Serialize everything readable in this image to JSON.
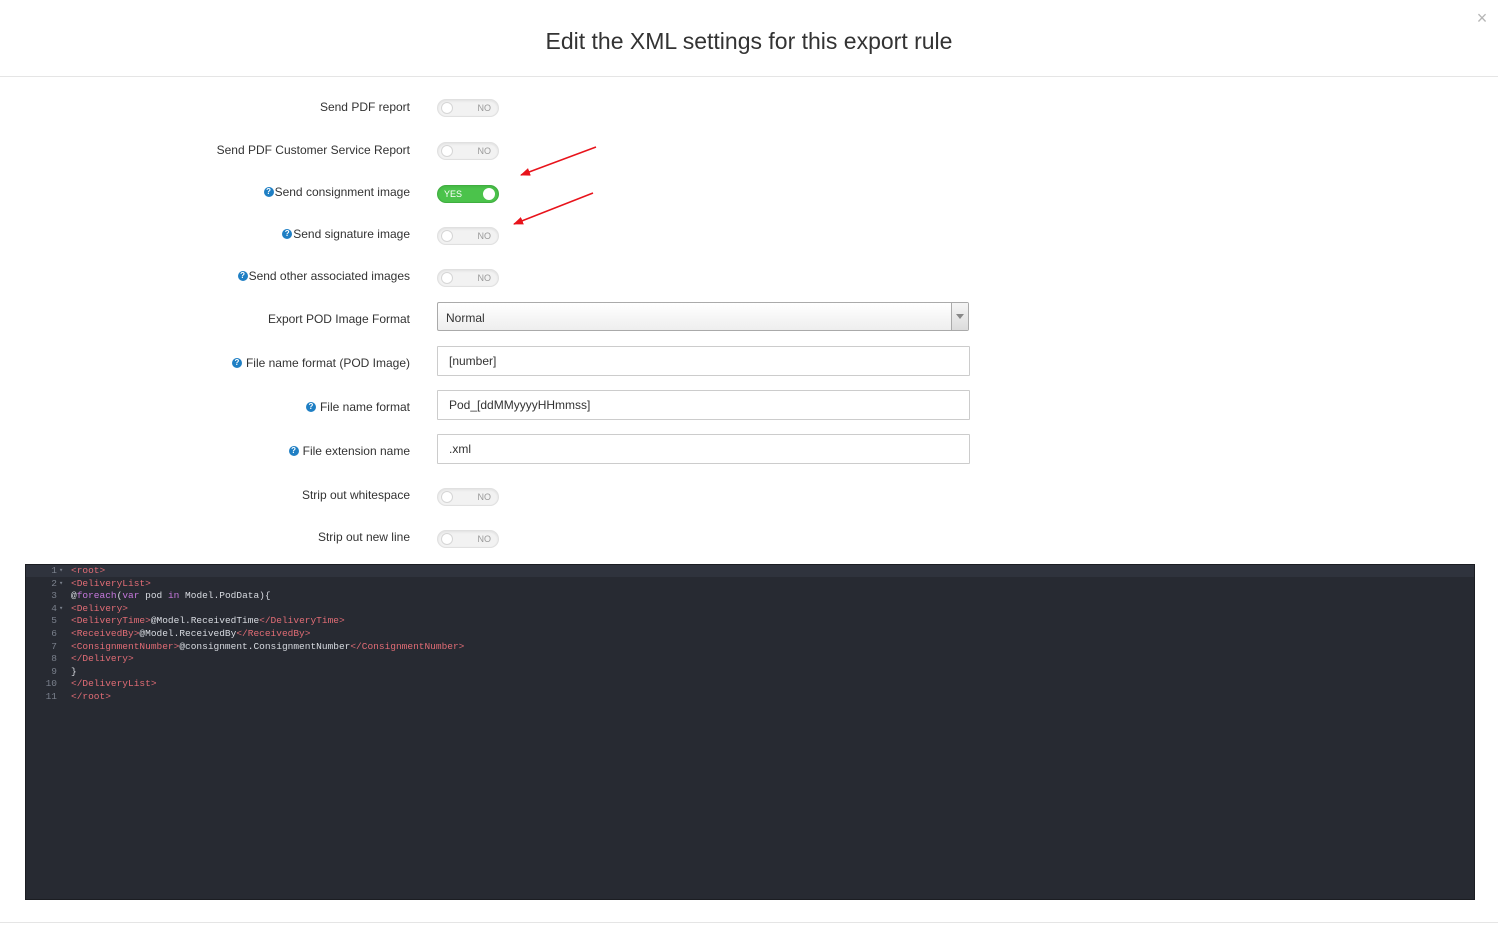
{
  "modal": {
    "title": "Edit the XML settings for this export rule",
    "close_label": "×"
  },
  "settings": {
    "send_pdf_report": {
      "label": "Send PDF report",
      "state": "NO"
    },
    "send_pdf_csr": {
      "label": "Send PDF Customer Service Report",
      "state": "NO"
    },
    "send_consignment_image": {
      "label": "Send consignment image",
      "state": "YES"
    },
    "send_signature_image": {
      "label": "Send signature image",
      "state": "NO"
    },
    "send_other_images": {
      "label": "Send other associated images",
      "state": "NO"
    },
    "export_pod_format": {
      "label": "Export POD Image Format",
      "value": "Normal"
    },
    "file_name_pod": {
      "label": "File name format (POD Image)",
      "value": "[number]"
    },
    "file_name": {
      "label": "File name format",
      "value": "Pod_[ddMMyyyyHHmmss]"
    },
    "file_ext": {
      "label": "File extension name",
      "value": ".xml"
    },
    "strip_whitespace": {
      "label": "Strip out whitespace",
      "state": "NO"
    },
    "strip_newline": {
      "label": "Strip out new line",
      "state": "NO"
    }
  },
  "help_glyph": "?",
  "editor": {
    "lines": [
      {
        "n": "1",
        "fold": "▾",
        "code": "<root>"
      },
      {
        "n": "2",
        "fold": "▾",
        "code": "<DeliveryList>"
      },
      {
        "n": "3",
        "fold": "",
        "code": "@foreach(var pod in Model.PodData){"
      },
      {
        "n": "4",
        "fold": "▾",
        "code": "<Delivery>"
      },
      {
        "n": "5",
        "fold": "",
        "code": "<DeliveryTime>@Model.ReceivedTime</DeliveryTime>"
      },
      {
        "n": "6",
        "fold": "",
        "code": "<ReceivedBy>@Model.ReceivedBy</ReceivedBy>"
      },
      {
        "n": "7",
        "fold": "",
        "code": "<ConsignmentNumber>@consignment.ConsignmentNumber</ConsignmentNumber>"
      },
      {
        "n": "8",
        "fold": "",
        "code": "</Delivery>"
      },
      {
        "n": "9",
        "fold": "",
        "code": "}"
      },
      {
        "n": "10",
        "fold": "",
        "code": "</DeliveryList>"
      },
      {
        "n": "11",
        "fold": "",
        "code": "</root>"
      }
    ]
  },
  "colors": {
    "toggle_on": "#4bc34b",
    "annotation_arrow": "#e8131b",
    "editor_bg": "#272a32",
    "xml_tag": "#e06c75",
    "keyword": "#c678dd",
    "help_icon": "#1f7fc4"
  },
  "icons": [
    "close-icon",
    "help-icon",
    "chevron-down-icon",
    "fold-arrow-icon",
    "annotation-arrow"
  ]
}
